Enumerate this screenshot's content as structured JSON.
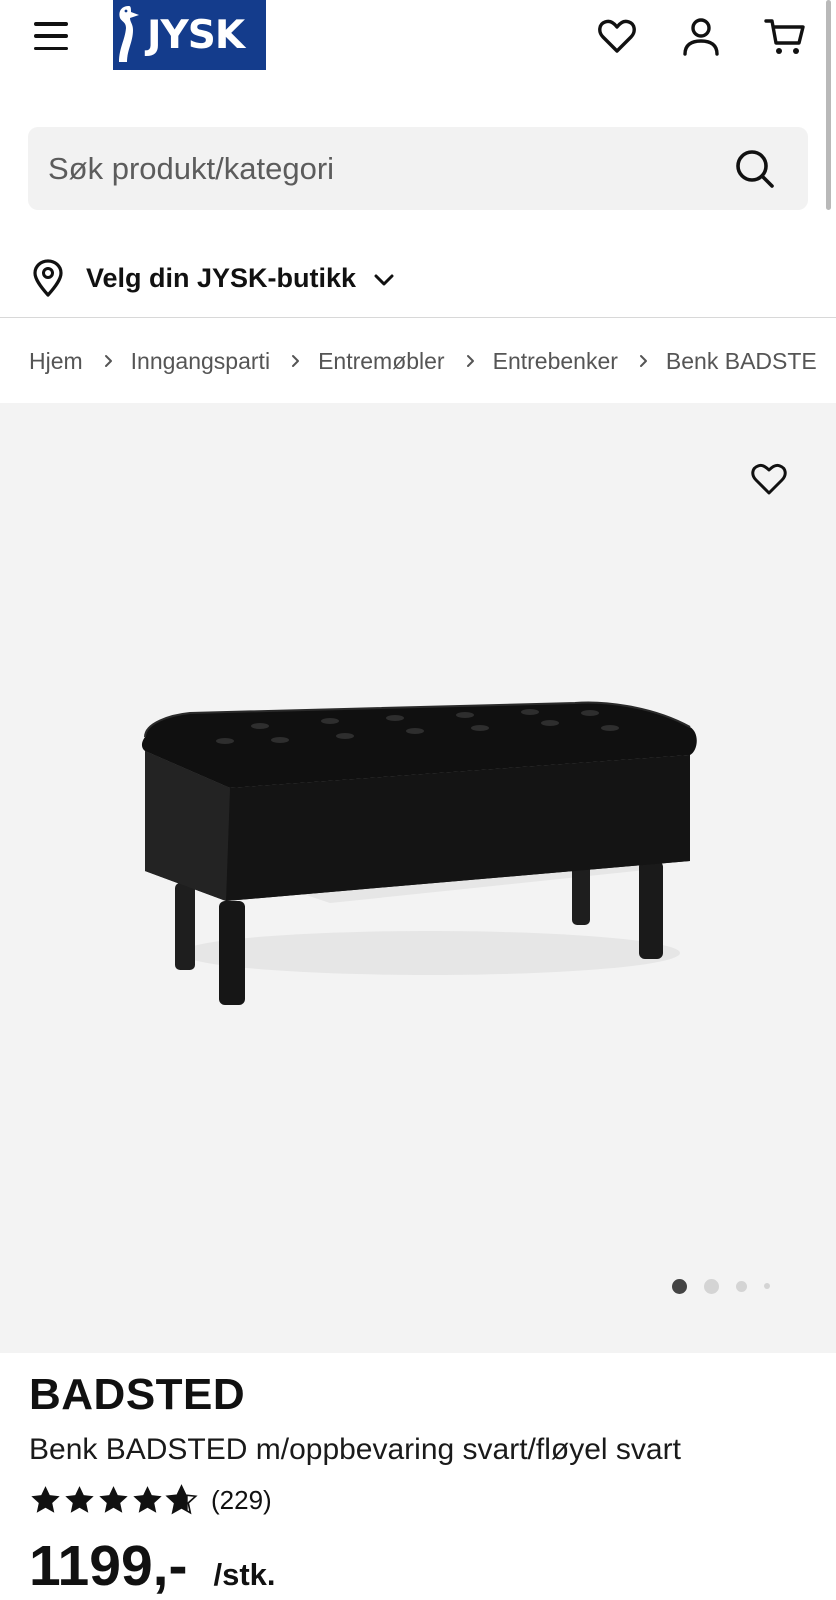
{
  "header": {
    "logo_text": "JYSK",
    "icons": [
      "menu-icon",
      "heart-icon",
      "user-icon",
      "cart-icon"
    ],
    "brand_color": "#143c8c"
  },
  "search": {
    "placeholder": "Søk produkt/kategori"
  },
  "store": {
    "label": "Velg din JYSK-butikk"
  },
  "breadcrumb": {
    "items": [
      "Hjem",
      "Inngangsparti",
      "Entremøbler",
      "Entrebenker",
      "Benk BADSTE"
    ]
  },
  "gallery": {
    "image_alt": "Benk BADSTED m/oppbevaring svart/fløyel svart",
    "slide_count": 4,
    "active_slide": 1
  },
  "product": {
    "brand": "BADSTED",
    "name": "Benk BADSTED m/oppbevaring svart/fløyel svart",
    "rating_value": 4.7,
    "rating_max": 5,
    "reviews": "(229)",
    "price": "1199,-",
    "unit": "/stk."
  }
}
